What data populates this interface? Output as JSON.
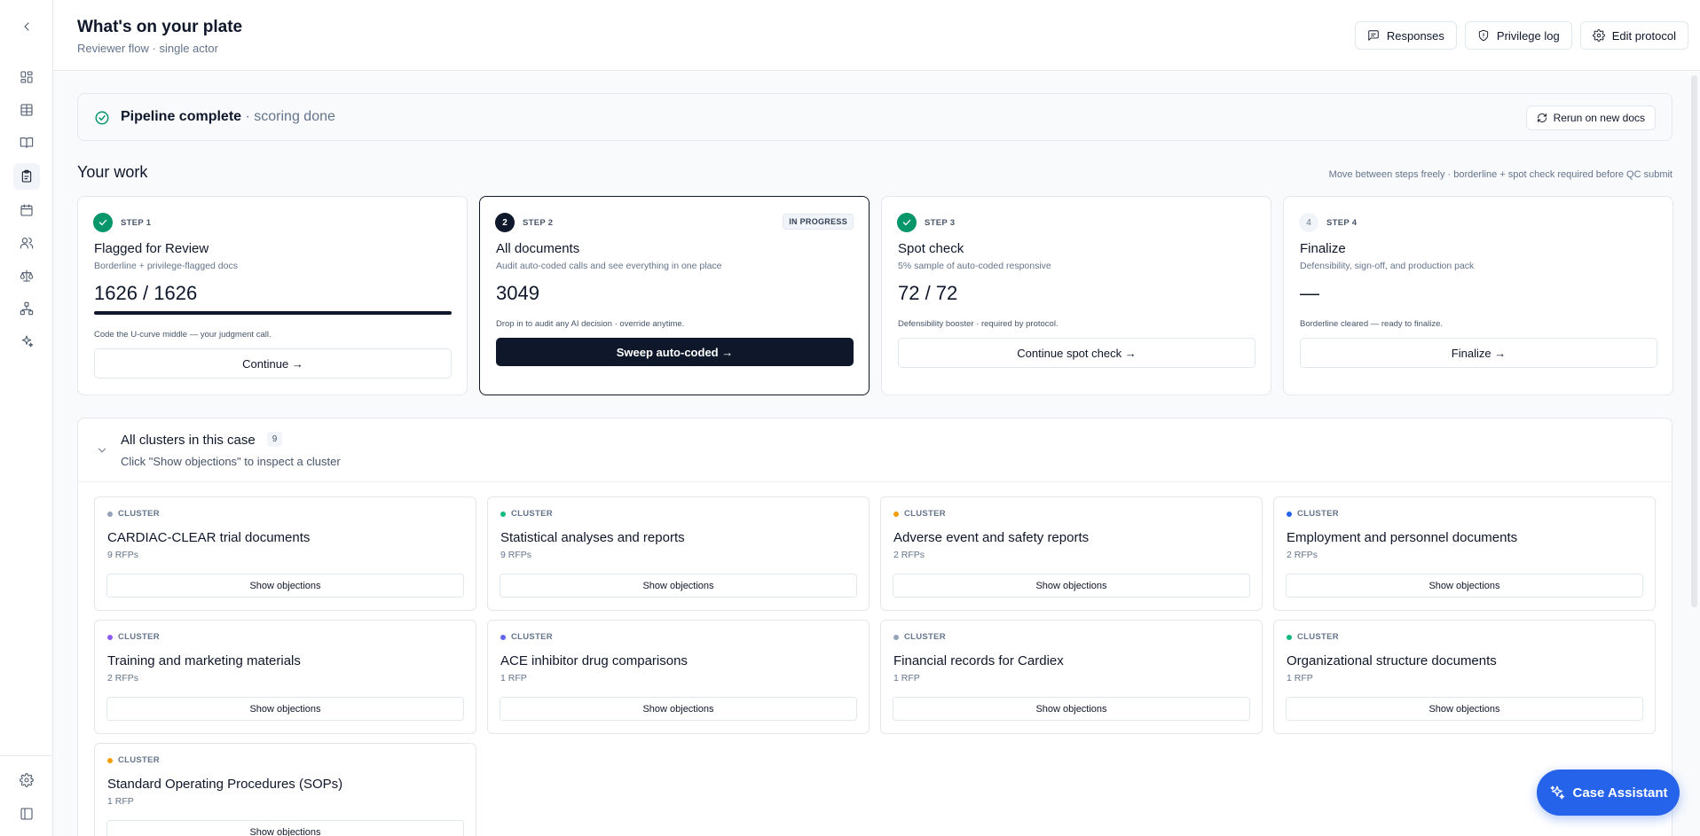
{
  "header": {
    "title": "What's on your plate",
    "subtitle": "Reviewer flow · single actor",
    "buttons": [
      {
        "label": "Responses",
        "icon": "message-square-icon"
      },
      {
        "label": "Privilege log",
        "icon": "shield-icon"
      },
      {
        "label": "Edit protocol",
        "icon": "gear-icon"
      }
    ]
  },
  "sidebar": {
    "items": [
      {
        "name": "back",
        "icon": "chevron-left-icon"
      },
      {
        "name": "dashboard",
        "icon": "layout-grid-icon"
      },
      {
        "name": "table",
        "icon": "table-icon"
      },
      {
        "name": "book",
        "icon": "book-open-icon"
      },
      {
        "name": "clipboard",
        "icon": "clipboard-icon",
        "active": true
      },
      {
        "name": "calendar",
        "icon": "calendar-icon"
      },
      {
        "name": "users",
        "icon": "users-icon"
      },
      {
        "name": "scale",
        "icon": "scale-icon"
      },
      {
        "name": "hierarchy",
        "icon": "network-icon"
      },
      {
        "name": "sparkles",
        "icon": "sparkles-icon"
      },
      {
        "name": "settings",
        "icon": "gear-icon"
      },
      {
        "name": "panel",
        "icon": "panel-left-icon"
      }
    ]
  },
  "pipeline": {
    "status": "Pipeline complete",
    "detail": " · scoring done",
    "rerun_label": "Rerun on new docs",
    "status_color": "#059669"
  },
  "work": {
    "title": "Your work",
    "note": "Move between steps freely · borderline + spot check required before QC submit",
    "steps": [
      {
        "number": "1",
        "label": "STEP 1",
        "state": "done",
        "title": "Flagged for Review",
        "desc": "Borderline + privilege-flagged docs",
        "value": "1626 / 1626",
        "progress": 1.0,
        "hint": "Code the U-curve middle — your judgment call.",
        "button": "Continue →"
      },
      {
        "number": "2",
        "label": "STEP 2",
        "state": "current",
        "status": "IN PROGRESS",
        "title": "All documents",
        "desc": "Audit auto-coded calls and see everything in one place",
        "value": "3049",
        "hint": "Drop in to audit any AI decision · override anytime.",
        "button": "Sweep auto-coded →"
      },
      {
        "number": "3",
        "label": "STEP 3",
        "state": "done",
        "title": "Spot check",
        "desc": "5% sample of auto-coded responsive",
        "value": "72 / 72",
        "hint": "Defensibility booster · required by protocol.",
        "button": "Continue spot check →"
      },
      {
        "number": "4",
        "label": "STEP 4",
        "state": "pending",
        "title": "Finalize",
        "desc": "Defensibility, sign-off, and production pack",
        "value": "—",
        "hint": "Borderline cleared — ready to finalize.",
        "button": "Finalize →"
      }
    ]
  },
  "clusters": {
    "title": "All clusters in this case",
    "count": "9",
    "subtitle": "Click \"Show objections\" to inspect a cluster",
    "kicker": "CLUSTER",
    "button_label": "Show objections",
    "items": [
      {
        "title": "CARDIAC-CLEAR trial documents",
        "meta": "9 RFPs",
        "color": "#94a3b8"
      },
      {
        "title": "Statistical analyses and reports",
        "meta": "9 RFPs",
        "color": "#10b981"
      },
      {
        "title": "Adverse event and safety reports",
        "meta": "2 RFPs",
        "color": "#f59e0b"
      },
      {
        "title": "Employment and personnel documents",
        "meta": "2 RFPs",
        "color": "#2563eb"
      },
      {
        "title": "Training and marketing materials",
        "meta": "2 RFPs",
        "color": "#8b5cf6"
      },
      {
        "title": "ACE inhibitor drug comparisons",
        "meta": "1 RFP",
        "color": "#6366f1"
      },
      {
        "title": "Financial records for Cardiex",
        "meta": "1 RFP",
        "color": "#94a3b8"
      },
      {
        "title": "Organizational structure documents",
        "meta": "1 RFP",
        "color": "#10b981"
      },
      {
        "title": "Standard Operating Procedures (SOPs)",
        "meta": "1 RFP",
        "color": "#f59e0b"
      }
    ]
  },
  "assistant": {
    "label": "Case Assistant",
    "icon": "sparkles-icon",
    "color": "#2563eb"
  }
}
